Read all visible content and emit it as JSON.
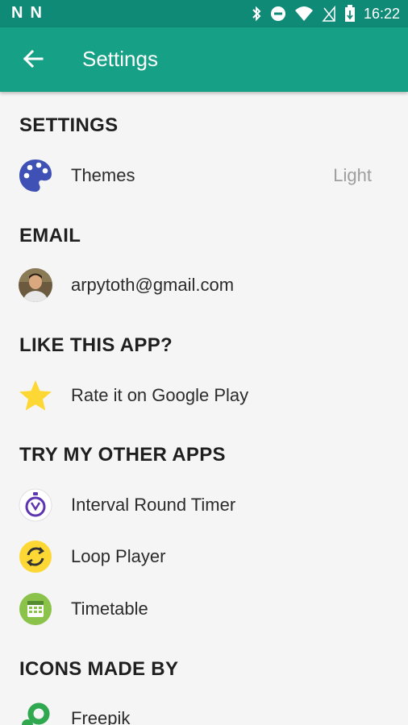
{
  "status": {
    "time": "16:22",
    "notif_icons": [
      "N",
      "N"
    ]
  },
  "appbar": {
    "title": "Settings"
  },
  "sections": {
    "settings": "SETTINGS",
    "email": "EMAIL",
    "like": "LIKE THIS APP?",
    "other_apps": "TRY MY OTHER APPS",
    "icons_by": "ICONS MADE BY"
  },
  "rows": {
    "themes": {
      "label": "Themes",
      "value": "Light"
    },
    "email": {
      "label": "arpytoth@gmail.com"
    },
    "rate": {
      "label": "Rate it on Google Play"
    },
    "timer": {
      "label": "Interval Round Timer"
    },
    "loop": {
      "label": "Loop Player"
    },
    "timetable": {
      "label": "Timetable"
    },
    "freepik": {
      "label": "Freepik"
    }
  },
  "colors": {
    "statusbar": "#0e8a76",
    "appbar": "#16a085",
    "palette": "#3f51b5",
    "star": "#fdd835",
    "timetable": "#8bc34a",
    "freepik": "#2fa84f"
  }
}
